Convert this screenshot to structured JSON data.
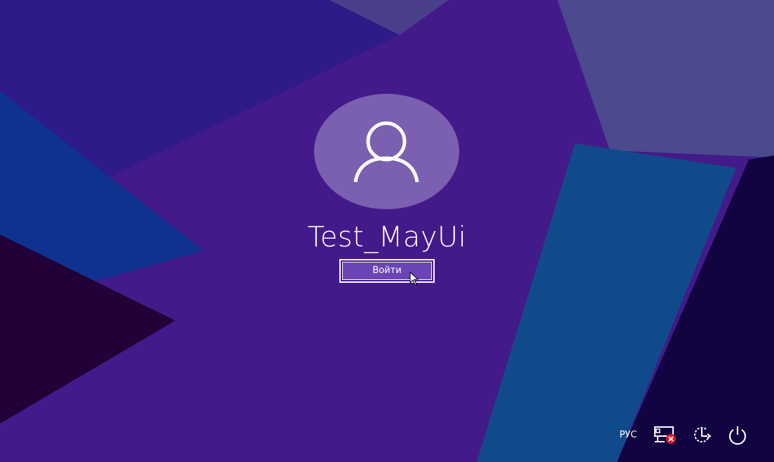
{
  "user": {
    "name": "Test_MayUi",
    "signin_label": "Войти"
  },
  "tray": {
    "language": "РУС",
    "network_icon": "network-disconnected-icon",
    "accessibility_icon": "ease-of-access-icon",
    "power_icon": "power-icon"
  },
  "colors": {
    "background": "#431a8a",
    "avatar": "#7b5fb0",
    "button_fill": "#6a45b5",
    "error_badge": "#e81123"
  }
}
